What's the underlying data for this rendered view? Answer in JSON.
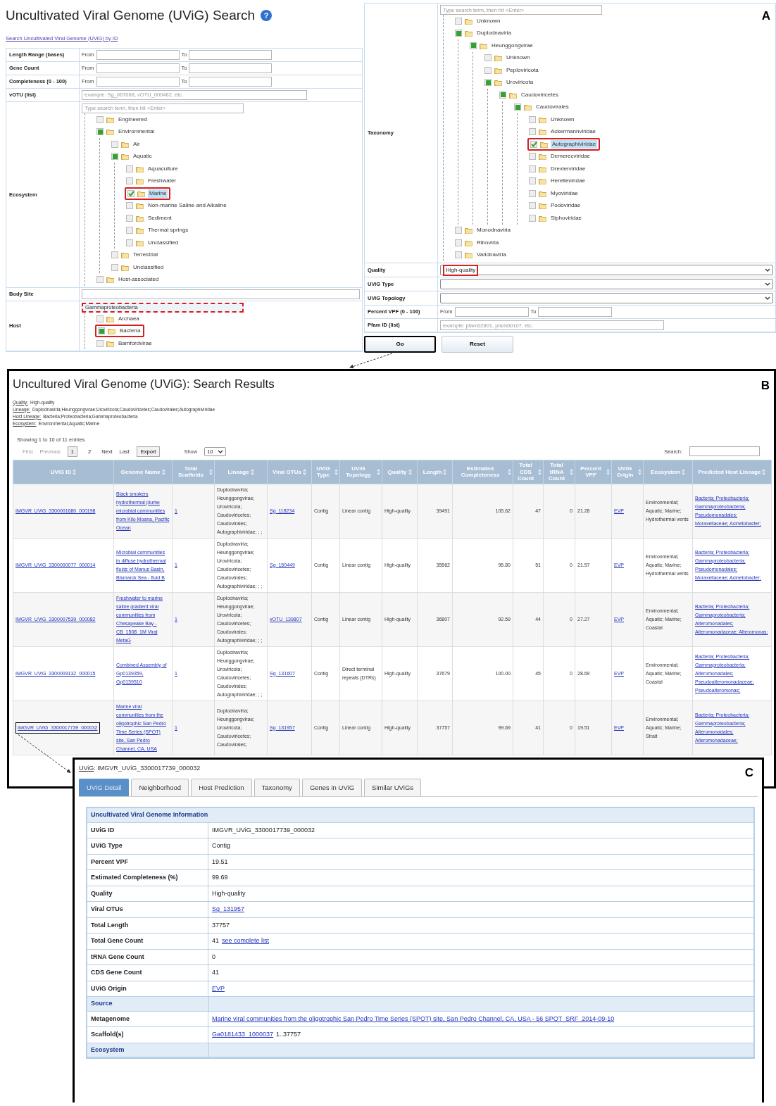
{
  "panel_a": {
    "label": "A",
    "title": "Uncultivated Viral Genome (UViG) Search",
    "help_icon": "?",
    "id_link": "Search Uncultivated Viral Genome (UViG) by ID",
    "left_rows": [
      {
        "kind": "range",
        "label": "Length Range (bases)",
        "from_label": "From",
        "to_label": "To"
      },
      {
        "kind": "range",
        "label": "Gene Count",
        "from_label": "From",
        "to_label": "To"
      },
      {
        "kind": "range",
        "label": "Completeness (0 - 100)",
        "from_label": "From",
        "to_label": "To"
      },
      {
        "kind": "text",
        "label": "vOTU (list)",
        "placeholder": "example: Sg_067068, vOTU_000462, etc."
      },
      {
        "kind": "tree",
        "label": "Ecosystem",
        "search_placeholder": "Type search term, then hit <Enter>",
        "search_highlighted": false,
        "nodes": [
          {
            "label": "Engineered",
            "checked": false,
            "partial": false,
            "highlighted": false
          },
          {
            "label": "Environmental",
            "checked": false,
            "partial": true,
            "highlighted": false,
            "children": [
              {
                "label": "Air",
                "checked": false,
                "partial": false,
                "highlighted": false
              },
              {
                "label": "Aquatic",
                "checked": false,
                "partial": true,
                "highlighted": false,
                "children": [
                  {
                    "label": "Aquaculture",
                    "checked": false,
                    "partial": false,
                    "highlighted": false
                  },
                  {
                    "label": "Freshwater",
                    "checked": false,
                    "partial": false,
                    "highlighted": false
                  },
                  {
                    "label": "Marine",
                    "checked": true,
                    "highlighted": true
                  },
                  {
                    "label": "Non-marine Saline and Alkaline",
                    "checked": false,
                    "partial": false,
                    "highlighted": false
                  },
                  {
                    "label": "Sediment",
                    "checked": false,
                    "partial": false,
                    "highlighted": false
                  },
                  {
                    "label": "Thermal springs",
                    "checked": false,
                    "partial": false,
                    "highlighted": false
                  },
                  {
                    "label": "Unclassified",
                    "checked": false,
                    "partial": false,
                    "highlighted": false
                  }
                ]
              },
              {
                "label": "Terrestrial",
                "checked": false,
                "partial": false,
                "highlighted": false
              },
              {
                "label": "Unclassified",
                "checked": false,
                "partial": false,
                "highlighted": false
              }
            ]
          },
          {
            "label": "Host-associated",
            "checked": false,
            "partial": false,
            "highlighted": false
          }
        ]
      },
      {
        "kind": "text",
        "label": "Body Site"
      },
      {
        "kind": "tree",
        "label": "Host",
        "search_value": "Gammaproteobacteria",
        "search_highlighted": true,
        "nodes": [
          {
            "label": "Archaea",
            "checked": false,
            "partial": false,
            "highlighted": false
          },
          {
            "label": "Bacteria",
            "checked": false,
            "partial": true,
            "highlighted": true
          },
          {
            "label": "Bamfordvirae",
            "checked": false,
            "partial": false,
            "highlighted": false
          }
        ]
      }
    ],
    "right_rows": [
      {
        "kind": "tree",
        "label": "Taxonomy",
        "search_placeholder": "Type search term, then hit <Enter>",
        "search_highlighted": false,
        "nodes": [
          {
            "label": "Unknown",
            "checked": false,
            "partial": false,
            "highlighted": false
          },
          {
            "label": "Duplodnaviria",
            "checked": false,
            "partial": true,
            "highlighted": false,
            "children": [
              {
                "label": "Heunggongvirae",
                "checked": false,
                "partial": true,
                "highlighted": false,
                "children": [
                  {
                    "label": "Unknown",
                    "checked": false,
                    "partial": false,
                    "highlighted": false
                  },
                  {
                    "label": "Peploviricota",
                    "checked": false,
                    "partial": false,
                    "highlighted": false
                  },
                  {
                    "label": "Uroviricota",
                    "checked": false,
                    "partial": true,
                    "highlighted": false,
                    "children": [
                      {
                        "label": "Caudoviricetes",
                        "checked": false,
                        "partial": true,
                        "highlighted": false,
                        "children": [
                          {
                            "label": "Caudovirales",
                            "checked": false,
                            "partial": true,
                            "highlighted": false,
                            "children": [
                              {
                                "label": "Unknown",
                                "checked": false,
                                "partial": false,
                                "highlighted": false
                              },
                              {
                                "label": "Ackermannviridae",
                                "checked": false,
                                "partial": false,
                                "highlighted": false
                              },
                              {
                                "label": "Autographiviridae",
                                "checked": true,
                                "highlighted": true
                              },
                              {
                                "label": "Demerecviridae",
                                "checked": false,
                                "partial": false,
                                "highlighted": false
                              },
                              {
                                "label": "Drexlerviridae",
                                "checked": false,
                                "partial": false,
                                "highlighted": false
                              },
                              {
                                "label": "Herelleviridae",
                                "checked": false,
                                "partial": false,
                                "highlighted": false
                              },
                              {
                                "label": "Myoviridae",
                                "checked": false,
                                "partial": false,
                                "highlighted": false
                              },
                              {
                                "label": "Podoviridae",
                                "checked": false,
                                "partial": false,
                                "highlighted": false
                              },
                              {
                                "label": "Siphoviridae",
                                "checked": false,
                                "partial": false,
                                "highlighted": false
                              }
                            ]
                          }
                        ]
                      }
                    ]
                  }
                ]
              }
            ]
          },
          {
            "label": "Monodnaviria",
            "checked": false,
            "partial": false,
            "highlighted": false
          },
          {
            "label": "Riboviria",
            "checked": false,
            "partial": false,
            "highlighted": false
          },
          {
            "label": "Varidnaviria",
            "checked": false,
            "partial": false,
            "highlighted": false
          }
        ]
      },
      {
        "kind": "select",
        "label": "Quality",
        "value": "High-quality",
        "highlighted": true
      },
      {
        "kind": "select",
        "label": "UViG Type"
      },
      {
        "kind": "select",
        "label": "UViG Topology"
      },
      {
        "kind": "range",
        "label": "Percent VPF (0 - 100)",
        "from_label": "From",
        "to_label": "To"
      },
      {
        "kind": "text",
        "label": "Pfam ID (list)",
        "placeholder": "example: pfam02801, pfam00107, etc."
      }
    ],
    "buttons": [
      {
        "label": "Go",
        "highlighted": true
      },
      {
        "label": "Reset",
        "highlighted": false
      }
    ]
  },
  "panel_b": {
    "label": "B",
    "title": "Uncultured Viral Genome (UViG): Search Results",
    "filters": [
      {
        "name": "Quality:",
        "value": "High-quality"
      },
      {
        "name": "Lineage:",
        "value": "Duplodnaviria;Heunggongvirae;Uroviricota;Caudoviricetes;Caudovirales;Autographiviridae"
      },
      {
        "name": "Host Lineage:",
        "value": "Bacteria;Proteobacteria;Gammaproteobacteria"
      },
      {
        "name": "Ecosystem:",
        "value": "Environmental;Aquatic;Marine"
      }
    ],
    "info": "Showing 1 to 10 of 11 entries",
    "nav_before": [
      {
        "label": "First",
        "disabled": true
      },
      {
        "label": "Previous",
        "disabled": true
      }
    ],
    "pages": [
      {
        "label": "1",
        "selected": true
      },
      {
        "label": "2",
        "selected": false
      }
    ],
    "nav_after": [
      {
        "label": "Next",
        "disabled": false
      },
      {
        "label": "Last",
        "disabled": false
      }
    ],
    "export": "Export",
    "show_label": "Show",
    "show_value": "10",
    "search_label": "Search:",
    "columns": [
      {
        "label": "UViG ID",
        "kind": "link"
      },
      {
        "label": "Genome Name",
        "kind": "link"
      },
      {
        "label": "Total Scaffolds",
        "kind": "link"
      },
      {
        "label": "Lineage",
        "kind": "text"
      },
      {
        "label": "Viral OTUs",
        "kind": "link"
      },
      {
        "label": "UViG Type",
        "kind": "text"
      },
      {
        "label": "UViG Topology",
        "kind": "text"
      },
      {
        "label": "Quality",
        "kind": "text"
      },
      {
        "label": "Length",
        "kind": "number"
      },
      {
        "label": "Estimated Completeness",
        "kind": "number"
      },
      {
        "label": "Total CDS Count",
        "kind": "number"
      },
      {
        "label": "Total tRNA Count",
        "kind": "number"
      },
      {
        "label": "Percent VPF",
        "kind": "text"
      },
      {
        "label": "UViG Origin",
        "kind": "link"
      },
      {
        "label": "Ecosystem",
        "kind": "text"
      },
      {
        "label": "Predicted Host Lineage",
        "kind": "link"
      }
    ],
    "rows": [
      {
        "highlighted": false,
        "cells": [
          "IMGVR_UViG_3300001680_000198",
          "Black smokers hydrothermal plume microbial communities from Kilo Moana, Pacific Ocean",
          "1",
          "Duplodnaviria; Heunggongvirae; Uroviricota; Caudoviricetes; Caudovirales; Autographiviridae; ; ;",
          "Sg_118234",
          "Contig",
          "Linear contig",
          "High-quality",
          "39491",
          "105.62",
          "47",
          "0",
          "21.28",
          "EVP",
          "Environmental; Aquatic; Marine; Hydrothermal vents",
          "Bacteria; Proteobacteria; Gammaproteobacteria; Pseudomonadales; Moraxellaceae; Acinetobacter;"
        ]
      },
      {
        "highlighted": false,
        "cells": [
          "IMGVR_UViG_3300000077_000014",
          "Microbial communities in diffuse hydrothermal fluids of Manus Basin, Bismarck Sea - fluid B",
          "1",
          "Duplodnaviria; Heunggongvirae; Uroviricota; Caudoviricetes; Caudovirales; Autographiviridae; ; ;",
          "Sg_150449",
          "Contig",
          "Linear contig",
          "High-quality",
          "35562",
          "95.80",
          "51",
          "0",
          "21.57",
          "EVP",
          "Environmental; Aquatic; Marine; Hydrothermal vents",
          "Bacteria; Proteobacteria; Gammaproteobacteria; Pseudomonadales; Moraxellaceae; Acinetobacter;"
        ]
      },
      {
        "highlighted": false,
        "cells": [
          "IMGVR_UViG_3300007539_000082",
          "Freshwater to marine saline gradient viral communities from Chesapeake Bay - CB_1508_1M Viral MetaG",
          "1",
          "Duplodnaviria; Heunggongvirae; Uroviricota; Caudoviricetes; Caudovirales; Autographiviridae; ; ;",
          "vOTU_139807",
          "Contig",
          "Linear contig",
          "High-quality",
          "36807",
          "92.59",
          "44",
          "0",
          "27.27",
          "EVP",
          "Environmental; Aquatic; Marine; Coastal",
          "Bacteria; Proteobacteria; Gammaproteobacteria; Alteromonadales; Alteromonadaceae; Alteromonas;"
        ]
      },
      {
        "highlighted": false,
        "cells": [
          "IMGVR_UViG_3300009132_000015",
          "Combined Assembly of Gp0139359, Gp0139510",
          "1",
          "Duplodnaviria; Heunggongvirae; Uroviricota; Caudoviricetes; Caudovirales; Autographiviridae; ; ;",
          "Sg_131607",
          "Contig",
          "Direct terminal repeats (DTRs)",
          "High-quality",
          "37679",
          "100.00",
          "45",
          "0",
          "28.69",
          "EVP",
          "Environmental; Aquatic; Marine; Coastal",
          "Bacteria; Proteobacteria; Gammaproteobacteria; Alteromonadales; Pseudoalteromonadaceae; Pseudoalteromonas;"
        ]
      },
      {
        "highlighted": true,
        "cells": [
          "IMGVR_UViG_3300017739_000032",
          "Marine viral communities from the oligotrophic San Pedro Time Series (SPOT) site, San Pedro Channel, CA, USA",
          "1",
          "Duplodnaviria; Heunggongvirae; Uroviricota; Caudoviricetes; Caudovirales;",
          "Sg_131957",
          "Contig",
          "Linear contig",
          "High-quality",
          "37757",
          "99.69",
          "41",
          "0",
          "19.51",
          "EVP",
          "Environmental; Aquatic; Marine; Strait",
          "Bacteria; Proteobacteria; Gammaproteobacteria; Alteromonadales; Alteromonadaceae;"
        ]
      }
    ]
  },
  "panel_c": {
    "label": "C",
    "heading_label": "UViG",
    "heading_value": ": IMGVR_UViG_3300017739_000032",
    "tabs": [
      {
        "label": "UViG Detail",
        "selected": true
      },
      {
        "label": "Neighborhood",
        "selected": false
      },
      {
        "label": "Host Prediction",
        "selected": false
      },
      {
        "label": "Taxonomy",
        "selected": false
      },
      {
        "label": "Genes in UViG",
        "selected": false
      },
      {
        "label": "Similar UViGs",
        "selected": false
      }
    ],
    "info_title": "Uncultivated Viral Genome Information",
    "rows": [
      {
        "kind": "field",
        "label": "UViG ID",
        "parts": [
          {
            "text": "IMGVR_UViG_3300017739_000032",
            "link": false
          }
        ]
      },
      {
        "kind": "field",
        "label": "UViG Type",
        "parts": [
          {
            "text": "Contig",
            "link": false
          }
        ]
      },
      {
        "kind": "field",
        "label": "Percent VPF",
        "parts": [
          {
            "text": "19.51",
            "link": false
          }
        ]
      },
      {
        "kind": "field",
        "label": "Estimated Completeness (%)",
        "parts": [
          {
            "text": "99.69",
            "link": false
          }
        ]
      },
      {
        "kind": "field",
        "label": "Quality",
        "parts": [
          {
            "text": "High-quality",
            "link": false
          }
        ]
      },
      {
        "kind": "field",
        "label": "Viral OTUs",
        "parts": [
          {
            "text": "Sg_131957",
            "link": true
          }
        ]
      },
      {
        "kind": "field",
        "label": "Total Length",
        "parts": [
          {
            "text": "37757",
            "link": false
          }
        ]
      },
      {
        "kind": "field",
        "label": "Total Gene Count",
        "parts": [
          {
            "text": "41",
            "link": false
          },
          {
            "text": "see complete list",
            "link": true
          }
        ]
      },
      {
        "kind": "field",
        "label": "tRNA Gene Count",
        "parts": [
          {
            "text": "0",
            "link": false
          }
        ]
      },
      {
        "kind": "field",
        "label": "CDS Gene Count",
        "parts": [
          {
            "text": "41",
            "link": false
          }
        ]
      },
      {
        "kind": "field",
        "label": "UViG Origin",
        "parts": [
          {
            "text": "EVP",
            "link": true
          }
        ]
      },
      {
        "kind": "section",
        "label": "Source"
      },
      {
        "kind": "field",
        "label": "Metagenome",
        "parts": [
          {
            "text": "Marine viral communities from the oligotrophic San Pedro Time Series (SPOT) site, San Pedro Channel, CA, USA - 56 SPOT_SRF_2014-09-10",
            "link": true
          }
        ]
      },
      {
        "kind": "field",
        "label": "Scaffold(s)",
        "parts": [
          {
            "text": "Ga0181433_1000037",
            "link": true
          },
          {
            "text": "1..37757",
            "link": false
          }
        ]
      },
      {
        "kind": "section",
        "label": "Ecosystem"
      }
    ]
  }
}
